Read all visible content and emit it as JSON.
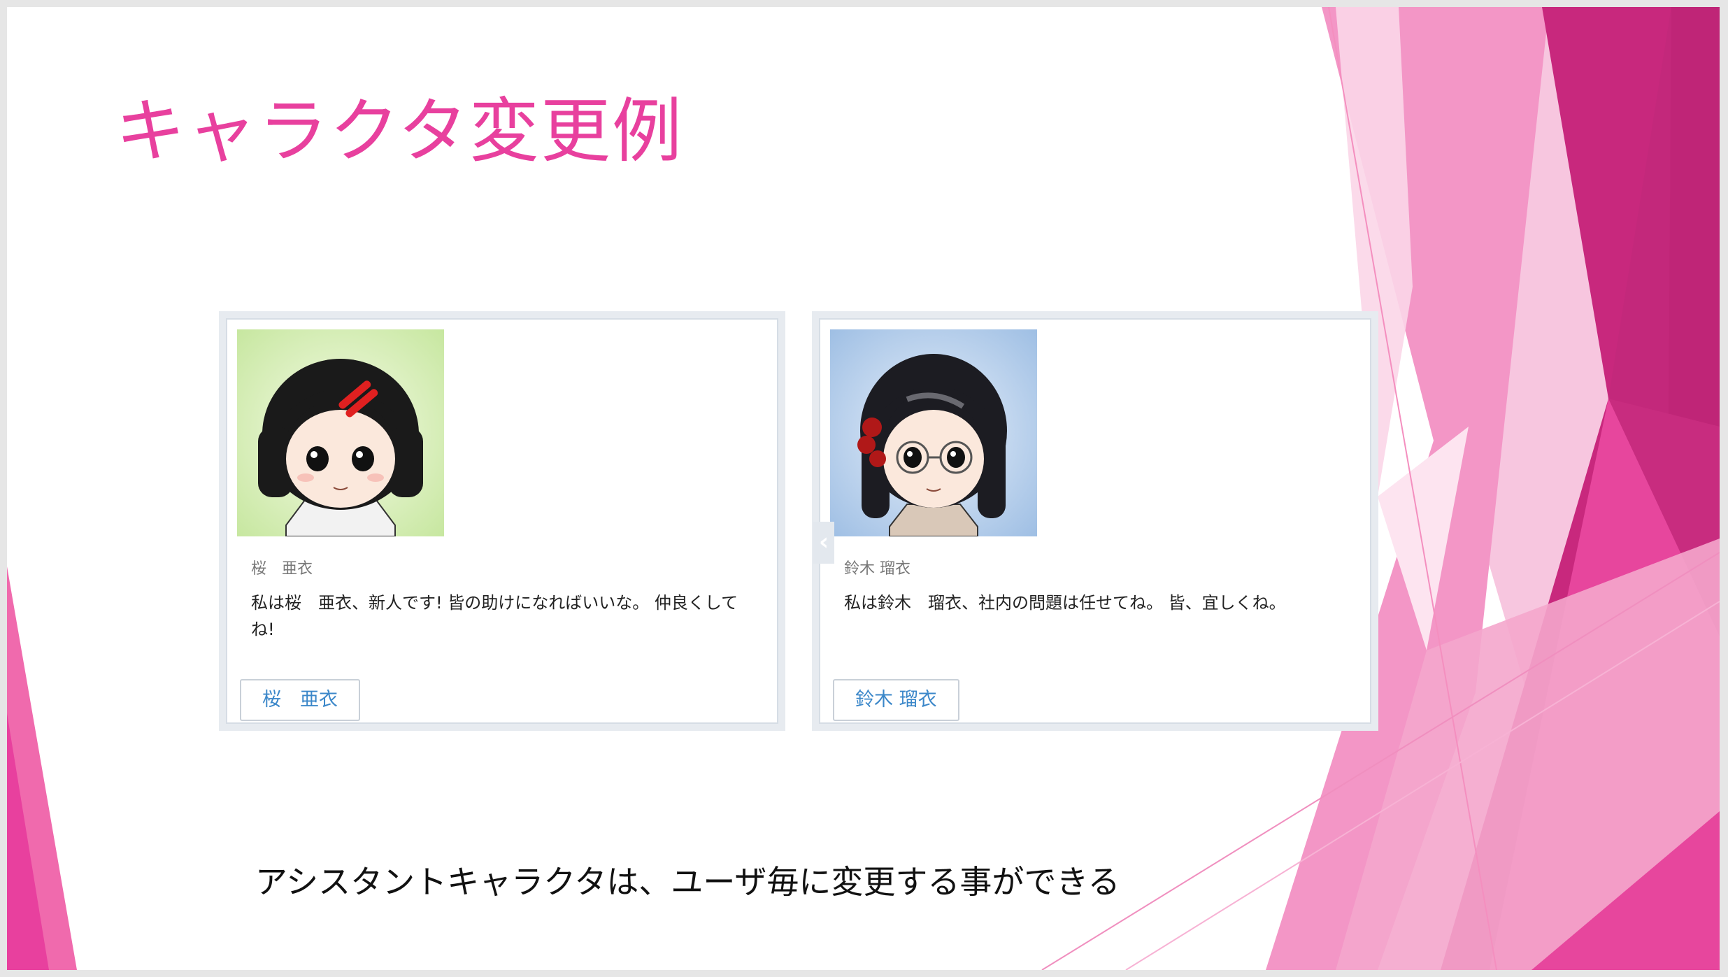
{
  "slide": {
    "title": "キャラクタ変更例",
    "caption": "アシスタントキャラクタは、ユーザ毎に変更する事ができる"
  },
  "characters": [
    {
      "name": "桜　亜衣",
      "description": "私は桜　亜衣、新人です! 皆の助けになればいいな。 仲良くしてね!",
      "button_label": "桜　亜衣",
      "avatar_icon": "girl-red-hairpin-avatar"
    },
    {
      "name": "鈴木 瑠衣",
      "description": "私は鈴木　瑠衣、社内の問題は任せてね。 皆、宜しくね。",
      "button_label": "鈴木 瑠衣",
      "avatar_icon": "girl-glasses-avatar"
    }
  ],
  "carousel": {
    "prev_icon": "chevron-left-icon",
    "prev_glyph": "‹"
  },
  "colors": {
    "title": "#e8409e",
    "accent_pink": "#ec4ea5",
    "accent_dark": "#b81c6e",
    "button_text": "#3b87c9"
  }
}
